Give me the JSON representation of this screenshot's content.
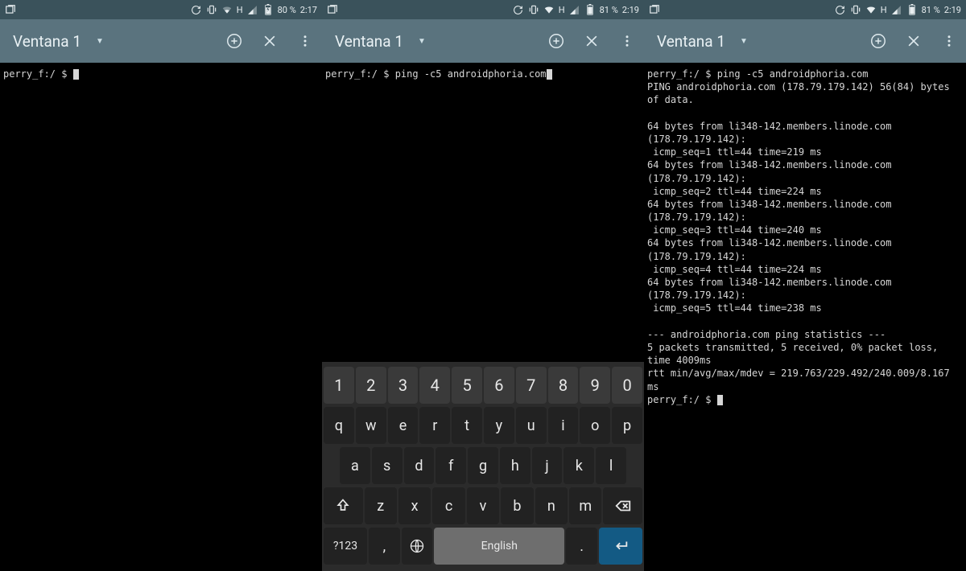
{
  "panels": [
    {
      "status": {
        "battery": "80 %",
        "time": "2:17",
        "netletter": "H"
      },
      "toolbar": {
        "title": "Ventana 1"
      },
      "terminal": {
        "lines": [
          "perry_f:/ $ "
        ],
        "trailing_cursor": true
      },
      "keyboard": null
    },
    {
      "status": {
        "battery": "81 %",
        "time": "2:19",
        "netletter": "H"
      },
      "toolbar": {
        "title": "Ventana 1"
      },
      "terminal": {
        "lines": [
          "perry_f:/ $ ping -c5 androidphoria.com"
        ],
        "trailing_cursor": true
      },
      "keyboard": {
        "rows": [
          [
            "1",
            "2",
            "3",
            "4",
            "5",
            "6",
            "7",
            "8",
            "9",
            "0"
          ],
          [
            "q",
            "w",
            "e",
            "r",
            "t",
            "y",
            "u",
            "i",
            "o",
            "p"
          ],
          [
            "a",
            "s",
            "d",
            "f",
            "g",
            "h",
            "j",
            "k",
            "l"
          ],
          [
            "⇧",
            "z",
            "x",
            "c",
            "v",
            "b",
            "n",
            "m",
            "⌫"
          ]
        ],
        "bottom": {
          "sym": "?123",
          "comma": ",",
          "globe": "globe",
          "space": "English",
          "dot": ".",
          "enter": "enter"
        }
      }
    },
    {
      "status": {
        "battery": "81 %",
        "time": "2:19",
        "netletter": "H"
      },
      "toolbar": {
        "title": "Ventana 1"
      },
      "terminal": {
        "lines": [
          "perry_f:/ $ ping -c5 androidphoria.com",
          "PING androidphoria.com (178.79.179.142) 56(84) bytes of data.",
          "",
          "64 bytes from li348-142.members.linode.com (178.79.179.142):",
          " icmp_seq=1 ttl=44 time=219 ms",
          "64 bytes from li348-142.members.linode.com (178.79.179.142):",
          " icmp_seq=2 ttl=44 time=224 ms",
          "64 bytes from li348-142.members.linode.com (178.79.179.142):",
          " icmp_seq=3 ttl=44 time=240 ms",
          "64 bytes from li348-142.members.linode.com (178.79.179.142):",
          " icmp_seq=4 ttl=44 time=224 ms",
          "64 bytes from li348-142.members.linode.com (178.79.179.142):",
          " icmp_seq=5 ttl=44 time=238 ms",
          "",
          "--- androidphoria.com ping statistics ---",
          "5 packets transmitted, 5 received, 0% packet loss, time 4009ms",
          "rtt min/avg/max/mdev = 219.763/229.492/240.009/8.167 ms",
          "perry_f:/ $ "
        ],
        "trailing_cursor": true
      },
      "keyboard": null
    }
  ]
}
